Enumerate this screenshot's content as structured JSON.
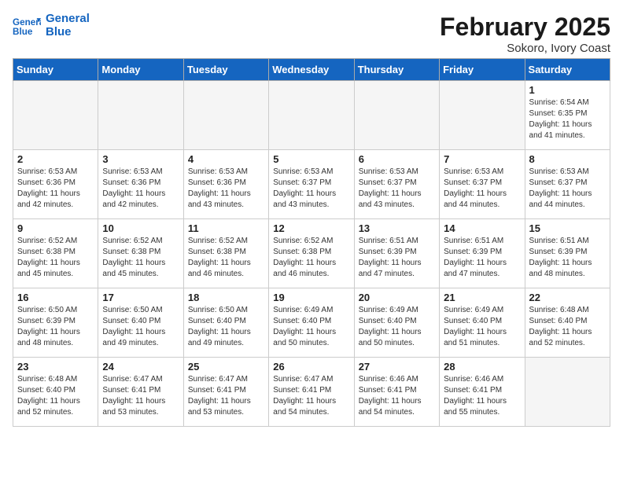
{
  "logo": {
    "general": "General",
    "blue": "Blue"
  },
  "title": "February 2025",
  "subtitle": "Sokoro, Ivory Coast",
  "days_of_week": [
    "Sunday",
    "Monday",
    "Tuesday",
    "Wednesday",
    "Thursday",
    "Friday",
    "Saturday"
  ],
  "weeks": [
    [
      {
        "day": "",
        "info": ""
      },
      {
        "day": "",
        "info": ""
      },
      {
        "day": "",
        "info": ""
      },
      {
        "day": "",
        "info": ""
      },
      {
        "day": "",
        "info": ""
      },
      {
        "day": "",
        "info": ""
      },
      {
        "day": "1",
        "info": "Sunrise: 6:54 AM\nSunset: 6:35 PM\nDaylight: 11 hours\nand 41 minutes."
      }
    ],
    [
      {
        "day": "2",
        "info": "Sunrise: 6:53 AM\nSunset: 6:36 PM\nDaylight: 11 hours\nand 42 minutes."
      },
      {
        "day": "3",
        "info": "Sunrise: 6:53 AM\nSunset: 6:36 PM\nDaylight: 11 hours\nand 42 minutes."
      },
      {
        "day": "4",
        "info": "Sunrise: 6:53 AM\nSunset: 6:36 PM\nDaylight: 11 hours\nand 43 minutes."
      },
      {
        "day": "5",
        "info": "Sunrise: 6:53 AM\nSunset: 6:37 PM\nDaylight: 11 hours\nand 43 minutes."
      },
      {
        "day": "6",
        "info": "Sunrise: 6:53 AM\nSunset: 6:37 PM\nDaylight: 11 hours\nand 43 minutes."
      },
      {
        "day": "7",
        "info": "Sunrise: 6:53 AM\nSunset: 6:37 PM\nDaylight: 11 hours\nand 44 minutes."
      },
      {
        "day": "8",
        "info": "Sunrise: 6:53 AM\nSunset: 6:37 PM\nDaylight: 11 hours\nand 44 minutes."
      }
    ],
    [
      {
        "day": "9",
        "info": "Sunrise: 6:52 AM\nSunset: 6:38 PM\nDaylight: 11 hours\nand 45 minutes."
      },
      {
        "day": "10",
        "info": "Sunrise: 6:52 AM\nSunset: 6:38 PM\nDaylight: 11 hours\nand 45 minutes."
      },
      {
        "day": "11",
        "info": "Sunrise: 6:52 AM\nSunset: 6:38 PM\nDaylight: 11 hours\nand 46 minutes."
      },
      {
        "day": "12",
        "info": "Sunrise: 6:52 AM\nSunset: 6:38 PM\nDaylight: 11 hours\nand 46 minutes."
      },
      {
        "day": "13",
        "info": "Sunrise: 6:51 AM\nSunset: 6:39 PM\nDaylight: 11 hours\nand 47 minutes."
      },
      {
        "day": "14",
        "info": "Sunrise: 6:51 AM\nSunset: 6:39 PM\nDaylight: 11 hours\nand 47 minutes."
      },
      {
        "day": "15",
        "info": "Sunrise: 6:51 AM\nSunset: 6:39 PM\nDaylight: 11 hours\nand 48 minutes."
      }
    ],
    [
      {
        "day": "16",
        "info": "Sunrise: 6:50 AM\nSunset: 6:39 PM\nDaylight: 11 hours\nand 48 minutes."
      },
      {
        "day": "17",
        "info": "Sunrise: 6:50 AM\nSunset: 6:40 PM\nDaylight: 11 hours\nand 49 minutes."
      },
      {
        "day": "18",
        "info": "Sunrise: 6:50 AM\nSunset: 6:40 PM\nDaylight: 11 hours\nand 49 minutes."
      },
      {
        "day": "19",
        "info": "Sunrise: 6:49 AM\nSunset: 6:40 PM\nDaylight: 11 hours\nand 50 minutes."
      },
      {
        "day": "20",
        "info": "Sunrise: 6:49 AM\nSunset: 6:40 PM\nDaylight: 11 hours\nand 50 minutes."
      },
      {
        "day": "21",
        "info": "Sunrise: 6:49 AM\nSunset: 6:40 PM\nDaylight: 11 hours\nand 51 minutes."
      },
      {
        "day": "22",
        "info": "Sunrise: 6:48 AM\nSunset: 6:40 PM\nDaylight: 11 hours\nand 52 minutes."
      }
    ],
    [
      {
        "day": "23",
        "info": "Sunrise: 6:48 AM\nSunset: 6:40 PM\nDaylight: 11 hours\nand 52 minutes."
      },
      {
        "day": "24",
        "info": "Sunrise: 6:47 AM\nSunset: 6:41 PM\nDaylight: 11 hours\nand 53 minutes."
      },
      {
        "day": "25",
        "info": "Sunrise: 6:47 AM\nSunset: 6:41 PM\nDaylight: 11 hours\nand 53 minutes."
      },
      {
        "day": "26",
        "info": "Sunrise: 6:47 AM\nSunset: 6:41 PM\nDaylight: 11 hours\nand 54 minutes."
      },
      {
        "day": "27",
        "info": "Sunrise: 6:46 AM\nSunset: 6:41 PM\nDaylight: 11 hours\nand 54 minutes."
      },
      {
        "day": "28",
        "info": "Sunrise: 6:46 AM\nSunset: 6:41 PM\nDaylight: 11 hours\nand 55 minutes."
      },
      {
        "day": "",
        "info": ""
      }
    ]
  ]
}
